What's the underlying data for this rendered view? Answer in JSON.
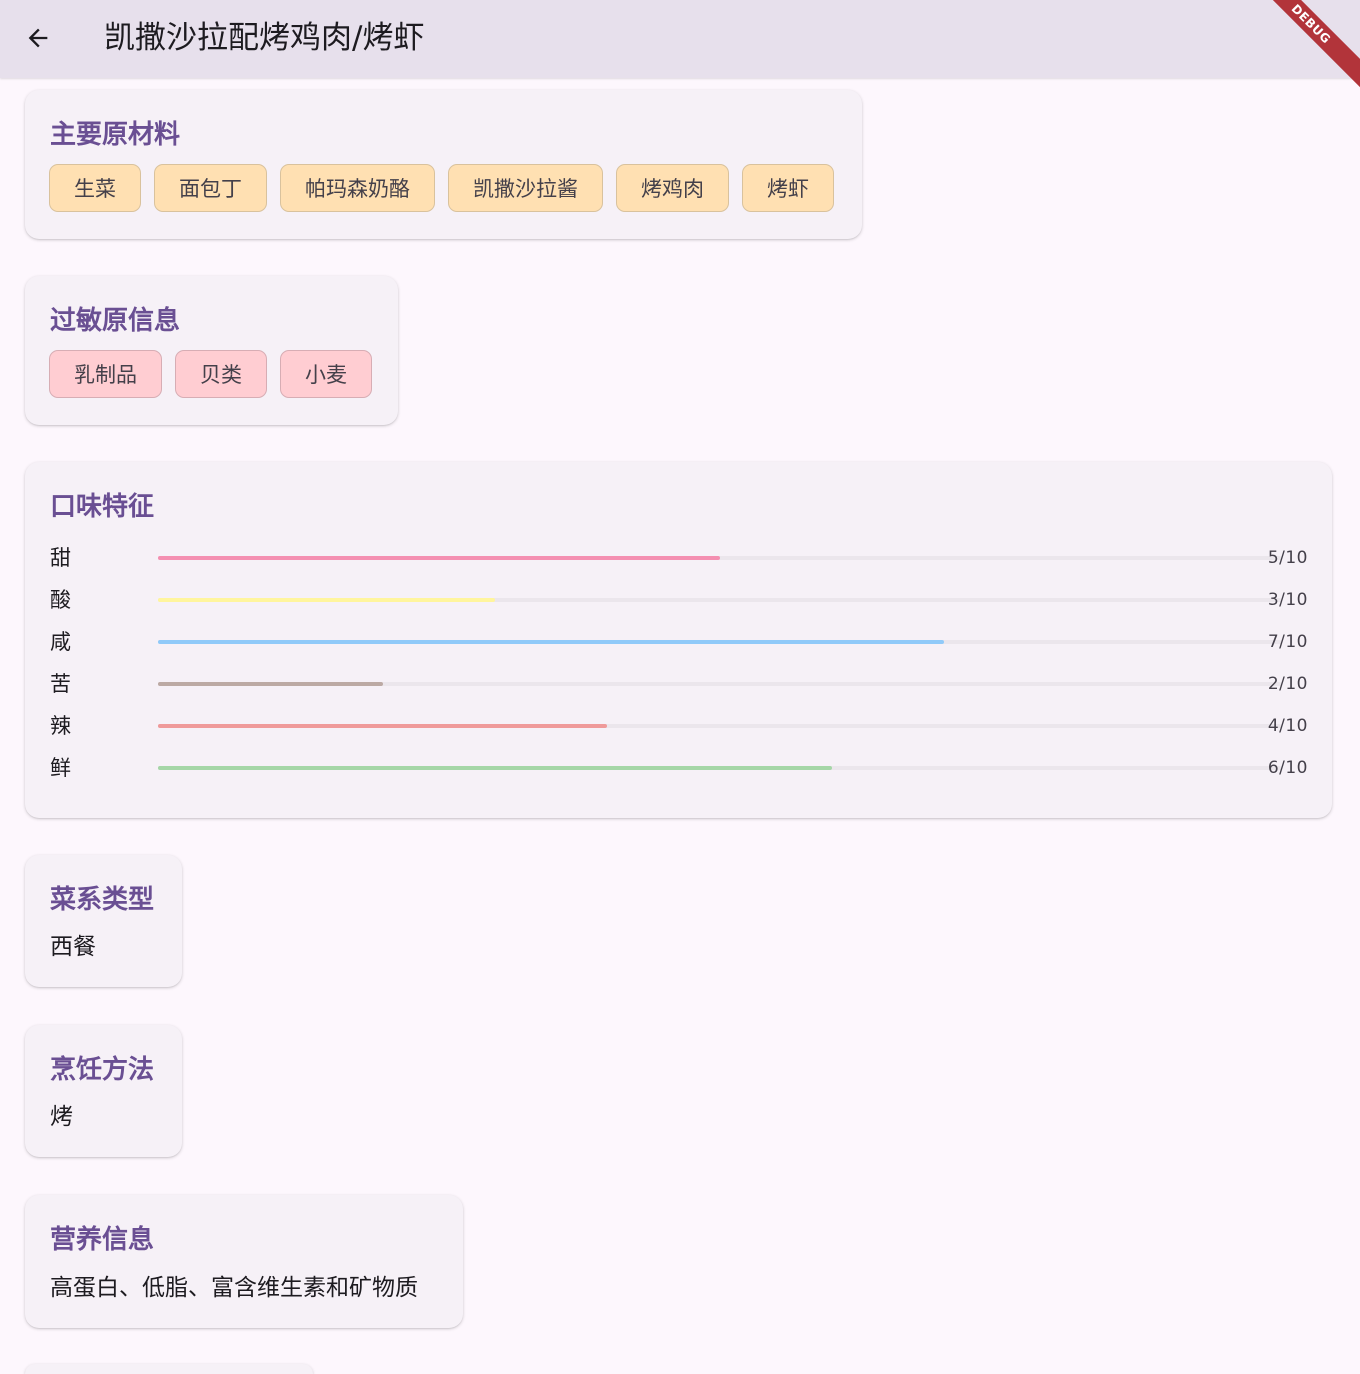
{
  "appbar": {
    "title": "凯撒沙拉配烤鸡肉/烤虾",
    "back_icon": "arrow-left-icon",
    "debug_label": "DEBUG",
    "background_color": "#e7e0ec"
  },
  "ingredients": {
    "title": "主要原材料",
    "items": [
      "生菜",
      "面包丁",
      "帕玛森奶酪",
      "凯撒沙拉酱",
      "烤鸡肉",
      "烤虾"
    ],
    "chip_color": "#ffe0b2"
  },
  "allergens": {
    "title": "过敏原信息",
    "items": [
      "乳制品",
      "贝类",
      "小麦"
    ],
    "chip_color": "#ffcdd2"
  },
  "taste": {
    "title": "口味特征",
    "max": 10,
    "items": [
      {
        "name": "甜",
        "score_text": "5/10",
        "value": 5,
        "color": "#f48fb1"
      },
      {
        "name": "酸",
        "score_text": "3/10",
        "value": 3,
        "color": "#fff59d"
      },
      {
        "name": "咸",
        "score_text": "7/10",
        "value": 7,
        "color": "#90caf9"
      },
      {
        "name": "苦",
        "score_text": "2/10",
        "value": 2,
        "color": "#bcaaa4"
      },
      {
        "name": "辣",
        "score_text": "4/10",
        "value": 4,
        "color": "#ef9a9a"
      },
      {
        "name": "鲜",
        "score_text": "6/10",
        "value": 6,
        "color": "#a5d6a7"
      }
    ]
  },
  "cuisine": {
    "title": "菜系类型",
    "value": "西餐"
  },
  "cooking": {
    "title": "烹饪方法",
    "value": "烤"
  },
  "nutrition": {
    "title": "营养信息",
    "value": "高蛋白、低脂、富含维生素和矿物质"
  },
  "accent_color": "#6a4f93"
}
